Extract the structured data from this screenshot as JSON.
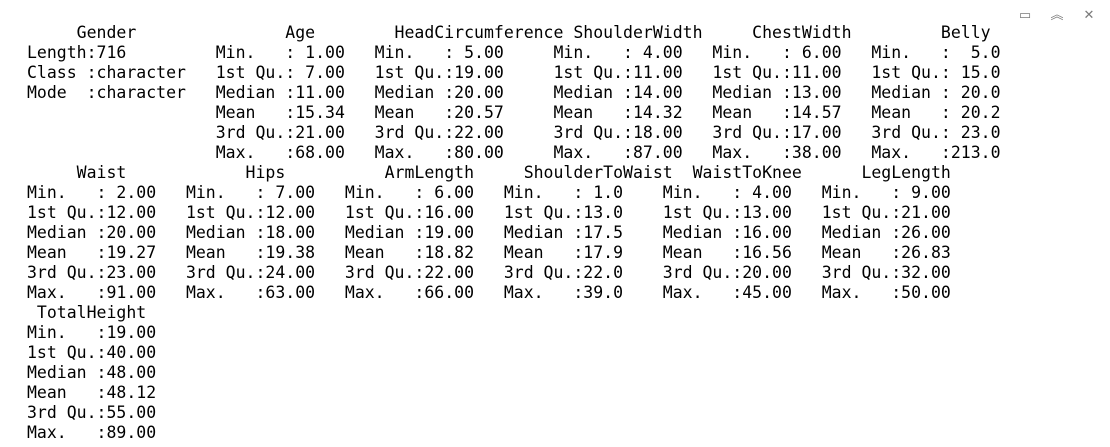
{
  "window": {
    "controls": [
      {
        "name": "restore-icon",
        "glyph": "▭"
      },
      {
        "name": "collapse-icon",
        "glyph": "︽"
      },
      {
        "name": "close-icon",
        "glyph": "✕"
      }
    ]
  },
  "console": {
    "lines": [
      "     Gender               Age        HeadCircumference ShoulderWidth     ChestWidth         Belly",
      "Length:716         Min.   : 1.00   Min.   : 5.00     Min.   : 4.00   Min.   : 6.00   Min.   :  5.0",
      "Class :character   1st Qu.: 7.00   1st Qu.:19.00     1st Qu.:11.00   1st Qu.:11.00   1st Qu.: 15.0",
      "Mode  :character   Median :11.00   Median :20.00     Median :14.00   Median :13.00   Median : 20.0",
      "                   Mean   :15.34   Mean   :20.57     Mean   :14.32   Mean   :14.57   Mean   : 20.2",
      "                   3rd Qu.:21.00   3rd Qu.:22.00     3rd Qu.:18.00   3rd Qu.:17.00   3rd Qu.: 23.0",
      "                   Max.   :68.00   Max.   :80.00     Max.   :87.00   Max.   :38.00   Max.   :213.0",
      "     Waist            Hips          ArmLength     ShoulderToWaist  WaistToKnee      LegLength",
      "Min.   : 2.00   Min.   : 7.00   Min.   : 6.00   Min.   : 1.0    Min.   : 4.00   Min.   : 9.00",
      "1st Qu.:12.00   1st Qu.:12.00   1st Qu.:16.00   1st Qu.:13.0    1st Qu.:13.00   1st Qu.:21.00",
      "Median :20.00   Median :18.00   Median :19.00   Median :17.5    Median :16.00   Median :26.00",
      "Mean   :19.27   Mean   :19.38   Mean   :18.82   Mean   :17.9    Mean   :16.56   Mean   :26.83",
      "3rd Qu.:23.00   3rd Qu.:24.00   3rd Qu.:22.00   3rd Qu.:22.0    3rd Qu.:20.00   3rd Qu.:32.00",
      "Max.   :91.00   Max.   :63.00   Max.   :66.00   Max.   :39.0    Max.   :45.00   Max.   :50.00",
      " TotalHeight",
      "Min.   :19.00",
      "1st Qu.:40.00",
      "Median :48.00",
      "Mean   :48.12",
      "3rd Qu.:55.00",
      "Max.   :89.00"
    ]
  }
}
